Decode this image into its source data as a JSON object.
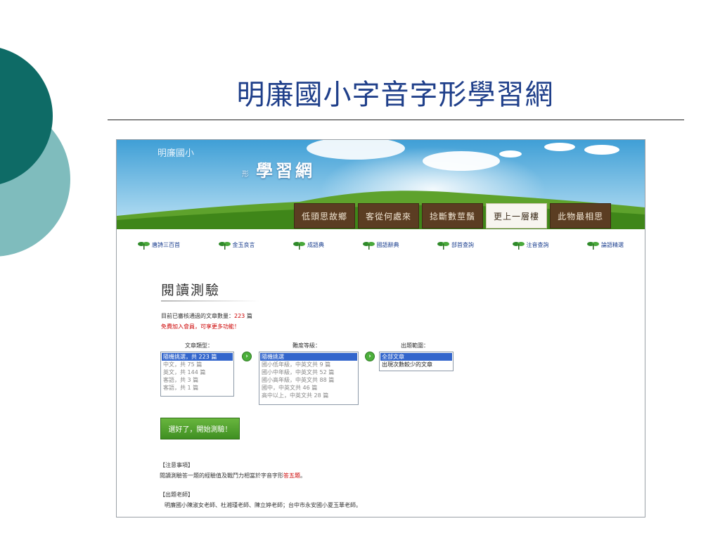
{
  "slide": {
    "title": "明廉國小字音字形學習網"
  },
  "site": {
    "logo_top": "明廉國小",
    "logo_small": "形",
    "logo_main": "學習網",
    "nav_tabs": [
      {
        "label": "低頭思故鄉",
        "active": false
      },
      {
        "label": "客從何處來",
        "active": false
      },
      {
        "label": "捻斷數莖鬚",
        "active": false
      },
      {
        "label": "更上一層樓",
        "active": true
      },
      {
        "label": "此物最相思",
        "active": false
      }
    ],
    "quick_links": [
      "唐詩三百首",
      "金玉良言",
      "成語典",
      "國語辭典",
      "部首查詢",
      "注音查詢",
      "論語精選"
    ]
  },
  "main": {
    "section_title": "閱讀測驗",
    "count_label": "目前已審核通過的文章數量：",
    "count_value": "223",
    "count_unit": " 篇",
    "member_link": "免費加入會員",
    "member_text": "，可享更多功能！",
    "columns": {
      "type_label": "文章類型：",
      "level_label": "難度等級：",
      "range_label": "出題範圍："
    },
    "type_options": [
      "隨機挑選，共 223 篇",
      "中文，共 75 篇",
      "英文，共 144 篇",
      "客語，共 3 篇",
      "客語，共 1 篇"
    ],
    "level_options": [
      "隨機挑選",
      "國小低年級，中英文共 9 篇",
      "國小中年級，中英文共 52 篇",
      "國小高年級，中英文共 88 篇",
      "國中，中英文共 46 篇",
      "高中以上，中英文共 28 篇"
    ],
    "range_options": [
      "全部文章",
      "出現次數較少的文章"
    ],
    "start_button": "選好了，開始測驗！",
    "notes_heading": "【注意事項】",
    "notes_text_a": "閱讀測驗答一題的經驗值及戰鬥力相當於字音字形",
    "notes_text_b": "答五題",
    "notes_text_c": "。",
    "teachers_heading": "【出題老師】",
    "teachers_text": "明廉國小陳淑女老師、杜湘瑾老師、陳立婷老師；台中市永安國小夏玉華老師。"
  },
  "colors": {
    "slide_circle_dark": "#0e6b66",
    "slide_circle_light": "#7fbcbd",
    "title": "#1f3f8a",
    "nav_tab": "#5b3d22",
    "selected_option": "#3366cc",
    "start_button": "#4f9f2d",
    "highlight": "#cc0000"
  }
}
